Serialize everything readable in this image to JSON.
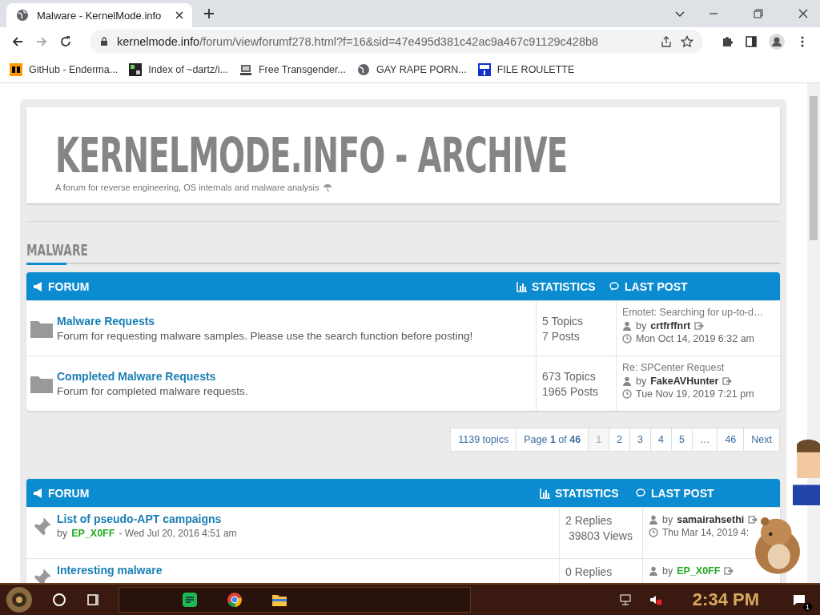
{
  "browser": {
    "tab_title": "Malware - KernelMode.info",
    "url_host": "kernelmode.info",
    "url_path": "/forum/viewforumf278.html?f=16&sid=47e495d381c42ac9a467c91129c428b8",
    "bookmarks": [
      {
        "label": "GitHub - Enderma...",
        "kind": "ph"
      },
      {
        "label": "Index of ~dartz/i...",
        "kind": "grid"
      },
      {
        "label": "Free Transgender...",
        "kind": "pc"
      },
      {
        "label": "GAY RAPE PORN...",
        "kind": "globe"
      },
      {
        "label": "FILE ROULETTE",
        "kind": "mft"
      }
    ]
  },
  "site": {
    "title": "KERNELMODE.INFO - ARCHIVE",
    "tagline": "A forum for reverse engineering, OS internals and malware analysis",
    "section": "MALWARE"
  },
  "forums": {
    "headers": [
      "FORUM",
      "STATISTICS",
      "LAST POST"
    ],
    "rows": [
      {
        "title": "Malware Requests",
        "desc": "Forum for requesting malware samples. Please use the search function before posting!",
        "stat1": "5 Topics",
        "stat2": "7 Posts",
        "last_title": "Emotet: Searching for up-to-d…",
        "by": "by",
        "author": "crtfrffnrt",
        "date": "Mon Oct 14, 2019 6:32 am"
      },
      {
        "title": "Completed Malware Requests",
        "desc": "Forum for completed malware requests.",
        "stat1": "673 Topics",
        "stat2": "1965 Posts",
        "last_title": "Re: SPCenter Request",
        "by": "by",
        "author": "FakeAVHunter",
        "date": "Tue Nov 19, 2019 7:21 pm"
      }
    ]
  },
  "pagination": {
    "count": "1139 topics",
    "page_prefix": "Page",
    "page_current": "1",
    "page_of": "of",
    "page_total": "46",
    "pages": [
      {
        "label": "1",
        "selected": true
      },
      {
        "label": "2",
        "selected": false
      },
      {
        "label": "3",
        "selected": false
      },
      {
        "label": "4",
        "selected": false
      },
      {
        "label": "5",
        "selected": false
      },
      {
        "label": "…",
        "selected": false
      },
      {
        "label": "46",
        "selected": false
      },
      {
        "label": "Next",
        "selected": false
      }
    ]
  },
  "topics": {
    "headers": [
      "FORUM",
      "STATISTICS",
      "LAST POST"
    ],
    "rows": [
      {
        "title": "List of pseudo-APT campaigns",
        "by": "by",
        "author": "EP_X0FF",
        "date": "- Wed Jul 20, 2016 4:51 am",
        "stat1": "2 Replies",
        "stat2": "39803 Views",
        "last_by": "by",
        "last_author": "samairahsethi",
        "last_date": "Thu Mar 14, 2019 4:"
      },
      {
        "title": "Interesting malware",
        "stat1": "0 Replies",
        "last_by": "by",
        "last_author": "EP_X0FF"
      }
    ]
  },
  "taskbar": {
    "time": "2:34 PM",
    "notifications": "1"
  }
}
